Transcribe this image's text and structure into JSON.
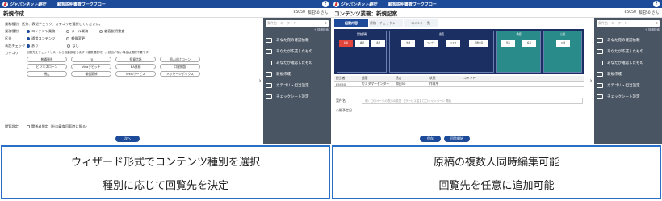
{
  "left": {
    "logo": "ジャパンネット銀行",
    "app_title": "顧客説明書査ワークフロー",
    "help": "?",
    "page_title": "新規作成",
    "user_code": "85050",
    "user_name": "和田50 さん",
    "rows": [
      {
        "label": "業務種別、区分、表記チェック、カテゴリを選択してください。",
        "options": []
      },
      {
        "label": "業務種別",
        "options": [
          {
            "text": "コンテンツ業務",
            "on": true
          },
          {
            "text": "メール業務",
            "on": false
          },
          {
            "text": "顧客説明書査",
            "on": false
          }
        ]
      },
      {
        "label": "区分",
        "options": [
          {
            "text": "通常コンテンツ",
            "on": true
          },
          {
            "text": "軽微変更",
            "on": false
          }
        ]
      },
      {
        "label": "表記チェック",
        "options": [
          {
            "text": "あり",
            "on": true
          },
          {
            "text": "なし",
            "on": false
          }
        ]
      },
      {
        "label": "カテゴリ",
        "options": [
          {
            "text": "回答先をチェックリストから自動設定します（複数選択可）。該当がない場合は選択不要です。",
            "on": false
          }
        ]
      }
    ],
    "chips": [
      "普通預金",
      "FX",
      "投資信託",
      "個人向けローン",
      "ビジネスローン",
      "Visaデビット",
      "BA業務",
      "口座開設",
      "規定",
      "補償関係",
      "WEBサービス",
      "メッセージボックス"
    ],
    "bottom_label": "閲覧設定",
    "bottom_opt": "関係者限定（社内審査回覧時に限る）",
    "next_button": "次へ",
    "sidebar": {
      "search_placeholder": "案件名・キーワード",
      "advanced": "＋ 詳細検索",
      "items": [
        "あなた宛の確認依頼",
        "あなたが作成したもの",
        "あなたが確認したもの",
        "新規作成",
        "カテゴリ・担当設定",
        "チェックシート設定"
      ]
    }
  },
  "right": {
    "logo": "ジャパンネット銀行",
    "app_title": "顧客説明書査ワークフロー",
    "help": "?",
    "page_title": "コンテンツ業務：新規起案",
    "user_code": "85050",
    "user_name": "和田50 さん",
    "tabs": [
      "起案内容",
      "原稿・チェックシート",
      "コメント一覧"
    ],
    "wf_groups": [
      {
        "head": "発信部署",
        "boxes": [
          "起案",
          "確認",
          "承認"
        ]
      },
      {
        "head": "審査",
        "boxes": [
          "法務",
          "コンプラ",
          "リスク",
          "業務企画"
        ]
      },
      {
        "head": "承認",
        "boxes": [
          "部長",
          "役員"
        ]
      },
      {
        "head": "公開",
        "boxes": [
          "公開"
        ]
      }
    ],
    "table_headers": [
      "担当者",
      "起票",
      "氏名",
      "状態",
      "コメント"
    ],
    "table_row": [
      "85050",
      "カスタマーセンター",
      "和田50",
      "作成中",
      ""
    ],
    "field1_label": "案件名",
    "field1_placeholder": "例：〇〇ページの表示の変更 【サービス名】〇〇キャンペーン 開始",
    "field2_label": "公開予定日",
    "buttons": [
      "保存",
      "回覧開始"
    ],
    "sidebar": {
      "search_placeholder": "案件名・キーワード",
      "advanced": "＋ 詳細検索",
      "items": [
        "あなた宛の確認依頼",
        "あなたが作成したもの",
        "あなたが確認したもの",
        "新規作成",
        "カテゴリ・担当設定",
        "チェックシート設定"
      ]
    }
  },
  "captions": {
    "left": [
      "ウィザード形式でコンテンツ種別を選択",
      "種別に応じて回覧先を決定"
    ],
    "right": [
      "原稿の複数人同時編集可能",
      "回覧先を任意に追加可能"
    ]
  }
}
